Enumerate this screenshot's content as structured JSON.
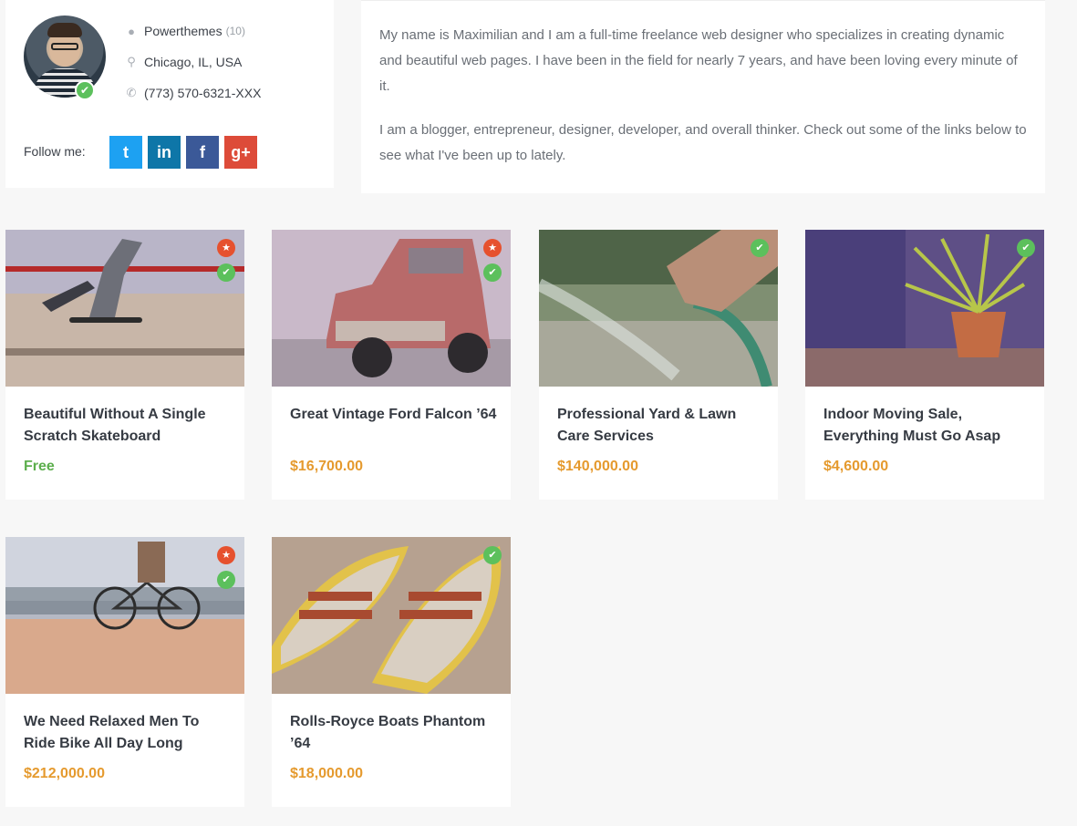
{
  "profile": {
    "name": "Powerthemes",
    "count": "(10)",
    "location": "Chicago, IL, USA",
    "phone": "(773) 570-6321-XXX",
    "follow_label": "Follow me:",
    "social": [
      {
        "icon": "twitter-icon",
        "glyph": "t",
        "color": "#1da1f2"
      },
      {
        "icon": "linkedin-icon",
        "glyph": "in",
        "color": "#0e76a8"
      },
      {
        "icon": "facebook-icon",
        "glyph": "f",
        "color": "#3b5998"
      },
      {
        "icon": "google-plus-icon",
        "glyph": "g+",
        "color": "#dd4b39"
      }
    ]
  },
  "about": {
    "paragraphs": [
      "My name is Maximilian and I am a full-time freelance web designer who specializes in creating dynamic and beautiful web pages. I have been in the field for nearly 7 years, and have been loving every minute of it.",
      "I am a blogger, entrepreneur, designer, developer, and overall thinker. Check out some of the links below to see what I've been up to lately."
    ]
  },
  "listings": [
    {
      "title": "Beautiful Without A Single Scratch Skateboard",
      "price": "Free",
      "featured": true,
      "verified": true,
      "image": "skateboard"
    },
    {
      "title": "Great Vintage Ford Falcon ’64",
      "price": "$16,700.00",
      "featured": true,
      "verified": true,
      "image": "vintage-truck"
    },
    {
      "title": "Professional Yard & Lawn Care Services",
      "price": "$140,000.00",
      "featured": false,
      "verified": true,
      "image": "garden-hose"
    },
    {
      "title": "Indoor Moving Sale, Everything Must Go Asap",
      "price": "$4,600.00",
      "featured": false,
      "verified": true,
      "image": "house-plant"
    },
    {
      "title": "We Need Relaxed Men To Ride Bike All Day Long",
      "price": "$212,000.00",
      "featured": true,
      "verified": true,
      "image": "bicycle"
    },
    {
      "title": "Rolls-Royce Boats Phantom ’64",
      "price": "$18,000.00",
      "featured": false,
      "verified": true,
      "image": "rowboats"
    }
  ],
  "colors": {
    "accent_price": "#e59a2e",
    "free_price": "#5cae4d",
    "verified": "#5cc05c",
    "featured": "#e6512e"
  }
}
